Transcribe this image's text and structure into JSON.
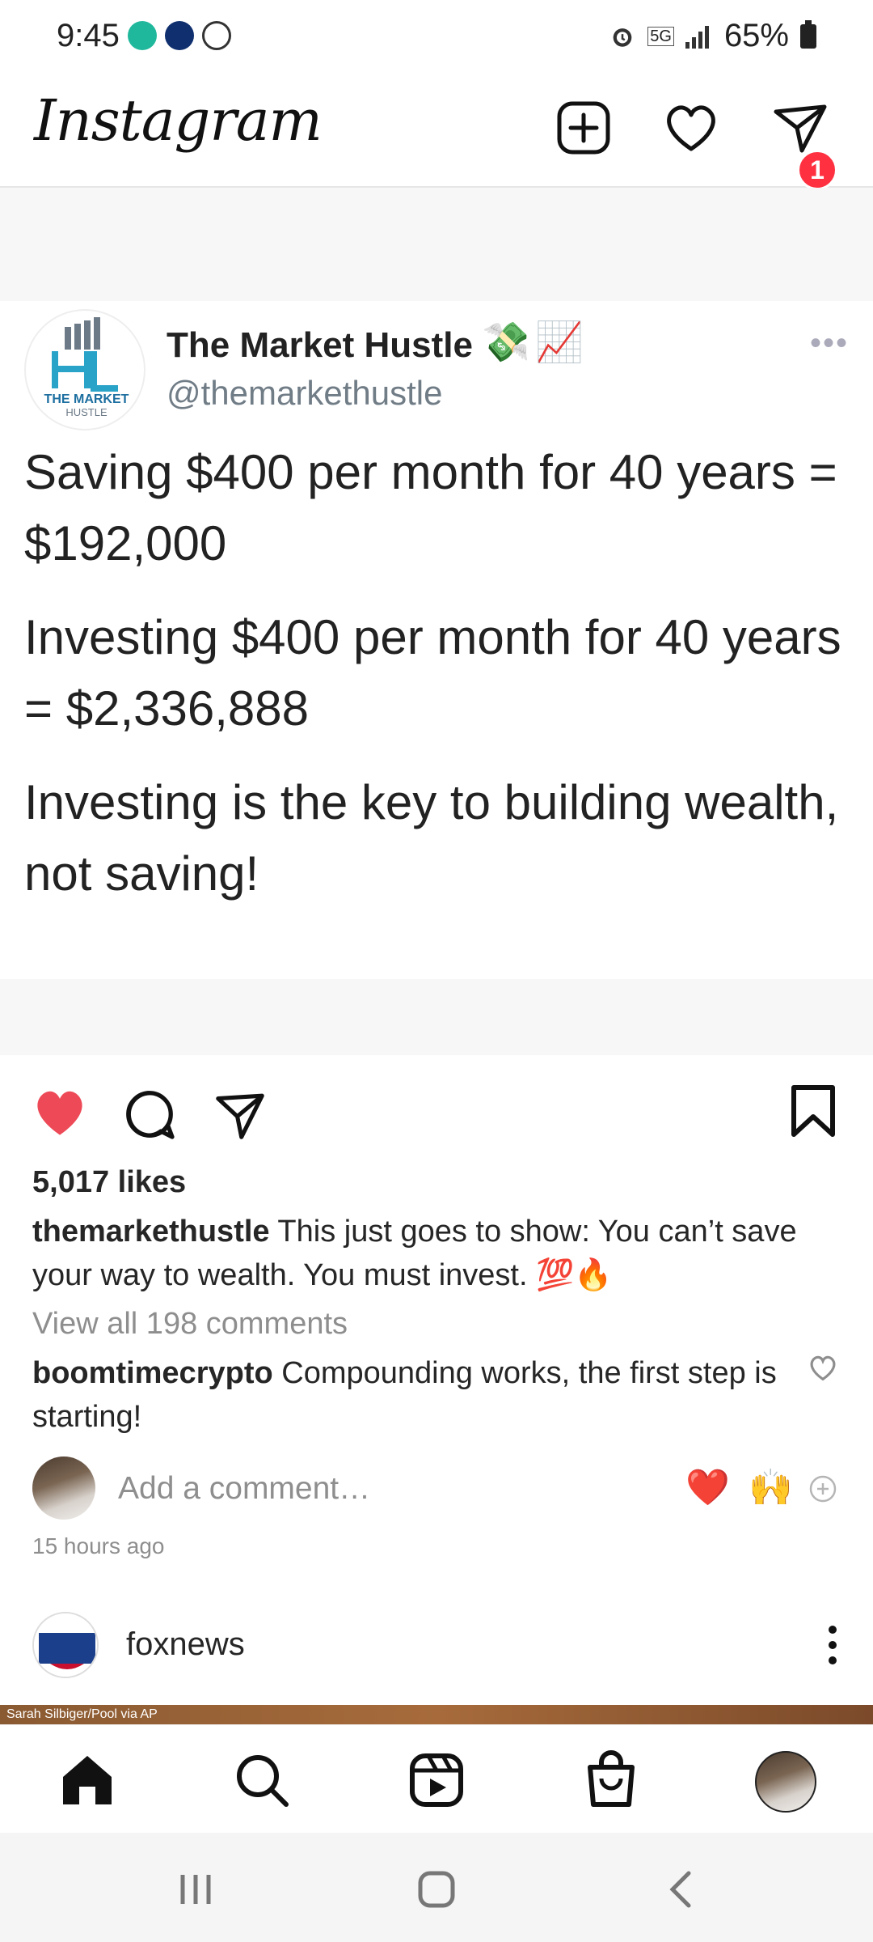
{
  "status_bar": {
    "time": "9:45",
    "network": "5G",
    "battery": "65%"
  },
  "header": {
    "logo": "Instagram",
    "notification_count": "1"
  },
  "post": {
    "tweet": {
      "name": "The Market Hustle",
      "handle": "@themarkethustle",
      "avatar_text_top": "THE MARKET",
      "avatar_text_bottom": "HUSTLE",
      "name_emojis": [
        "💸",
        "📈"
      ],
      "paragraphs": [
        "Saving $400 per month for 40 years = $192,000",
        "Investing $400 per month for 40 years = $2,336,888",
        "Investing is the key to building wealth, not saving!"
      ]
    },
    "likes": "5,017 likes",
    "caption": {
      "username": "themarkethustle",
      "text": " This just goes to show: You can’t save your way to wealth. You must invest. 💯🔥"
    },
    "view_all_comments": "View all 198 comments",
    "top_comment": {
      "username": "boomtimecrypto",
      "text": " Compounding works, the first step is starting!"
    },
    "add_comment_placeholder": "Add a comment…",
    "quick_reactions": [
      "❤️",
      "🙌"
    ],
    "timestamp": "15 hours ago"
  },
  "next_post": {
    "username": "foxnews",
    "photo_credit": "Sarah Silbiger/Pool via AP"
  },
  "colors": {
    "like_red": "#ed4956",
    "badge_red": "#ff3040",
    "muted_text": "#8e8e8e"
  }
}
